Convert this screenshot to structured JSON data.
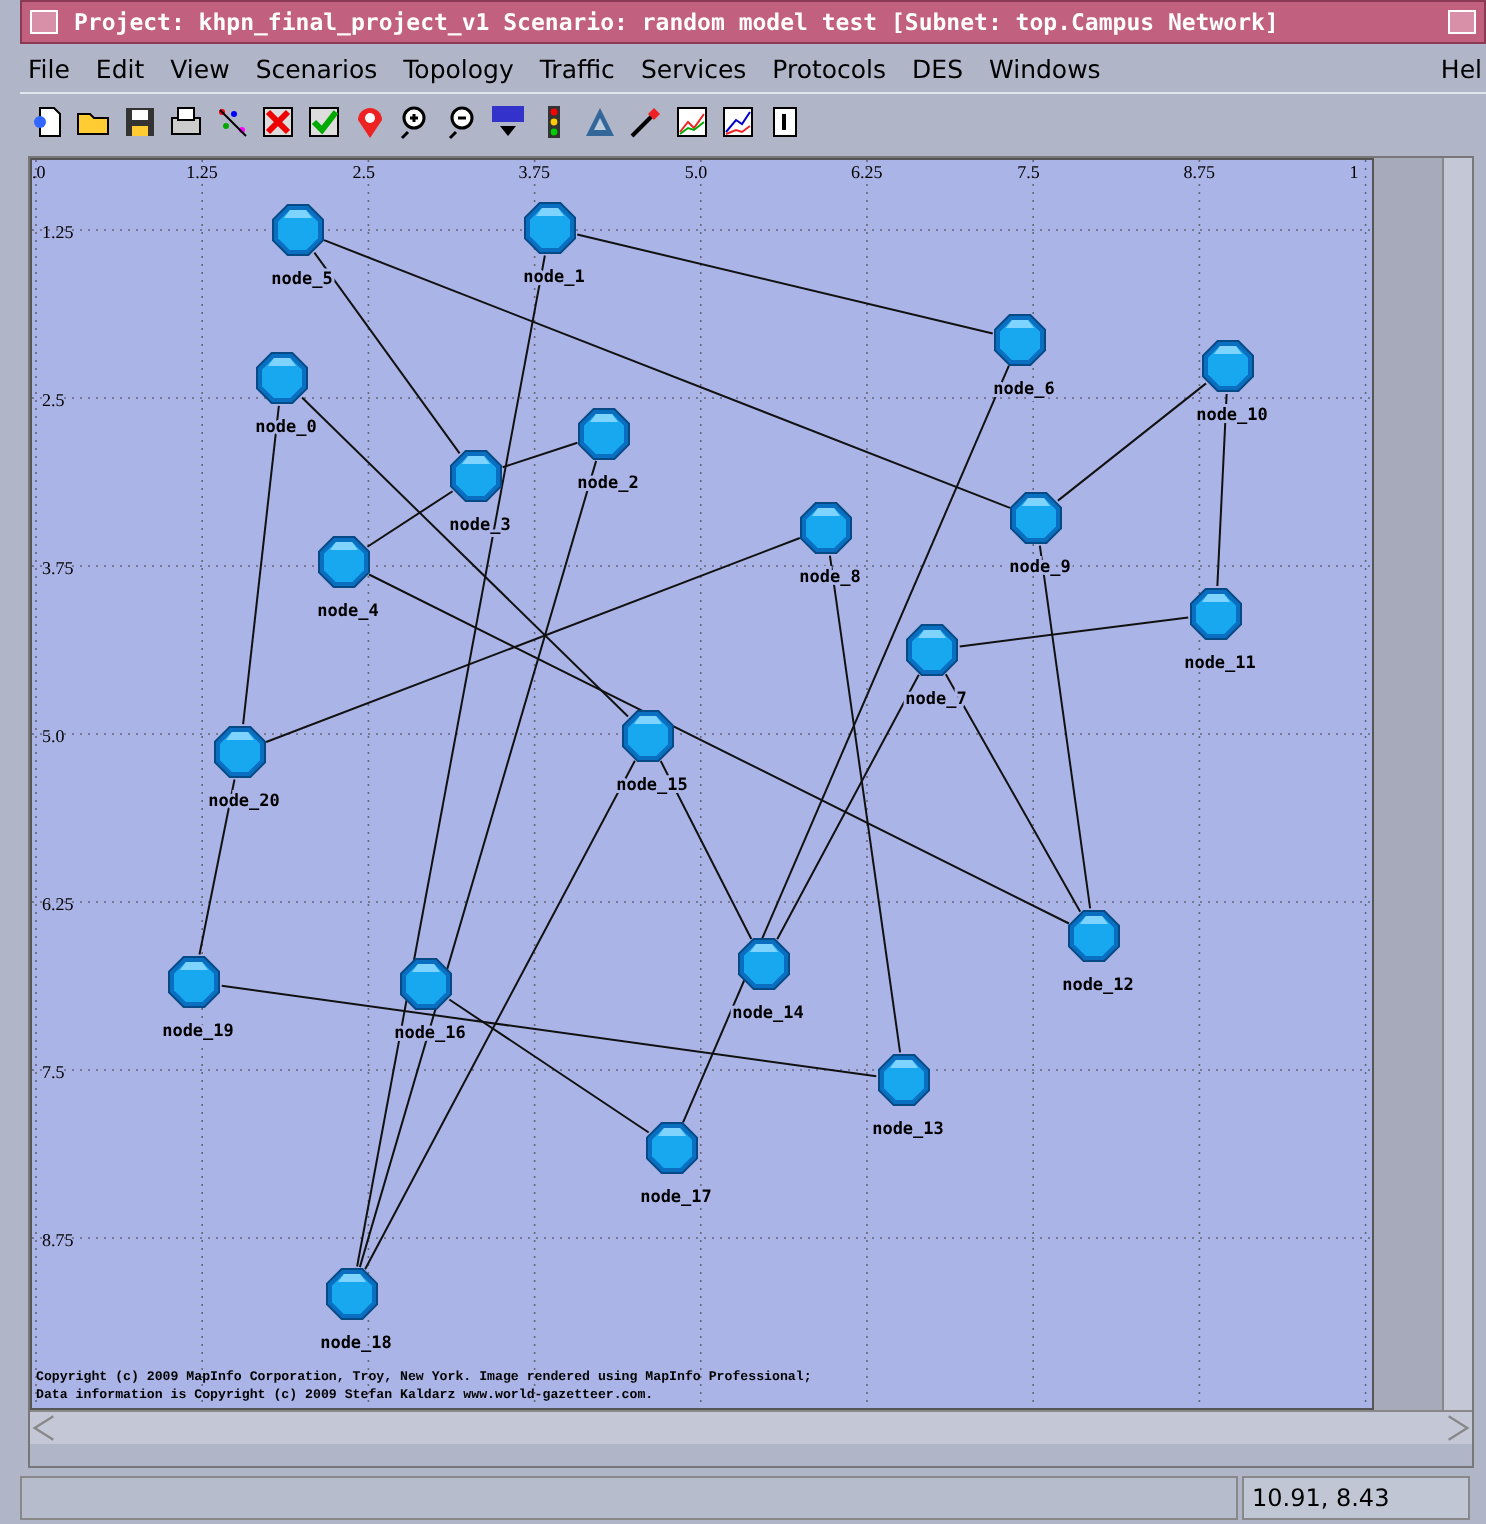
{
  "window": {
    "title": "Project: khpn_final_project_v1 Scenario: random model test  [Subnet: top.Campus Network]"
  },
  "menu": [
    "File",
    "Edit",
    "View",
    "Scenarios",
    "Topology",
    "Traffic",
    "Services",
    "Protocols",
    "DES",
    "Windows"
  ],
  "help_menu": "Hel",
  "map": {
    "x_ticks": [
      ".0",
      "1.25",
      "2.5",
      "3.75",
      "5.0",
      "6.25",
      "7.5",
      "8.75",
      "1"
    ],
    "y_ticks": [
      "1.25",
      "2.5",
      "3.75",
      "5.0",
      "6.25",
      "7.5",
      "8.75"
    ],
    "nodes": [
      {
        "label": "node_5"
      },
      {
        "label": "node_1"
      },
      {
        "label": "node_6"
      },
      {
        "label": "node_10"
      },
      {
        "label": "node_0"
      },
      {
        "label": "node_2"
      },
      {
        "label": "node_3"
      },
      {
        "label": "node_9"
      },
      {
        "label": "node_8"
      },
      {
        "label": "node_4"
      },
      {
        "label": "node_11"
      },
      {
        "label": "node_7"
      },
      {
        "label": "node_20"
      },
      {
        "label": "node_15"
      },
      {
        "label": "node_12"
      },
      {
        "label": "node_14"
      },
      {
        "label": "node_19"
      },
      {
        "label": "node_16"
      },
      {
        "label": "node_13"
      },
      {
        "label": "node_17"
      },
      {
        "label": "node_18"
      }
    ],
    "copyright": [
      "Copyright (c) 2009 MapInfo Corporation, Troy, New York. Image rendered using MapInfo Professional;",
      "Data information is Copyright (c) 2009 Stefan Kaldarz www.world-gazetteer.com."
    ]
  },
  "status_bar": {
    "coordinates": "10.91, 8.43"
  }
}
